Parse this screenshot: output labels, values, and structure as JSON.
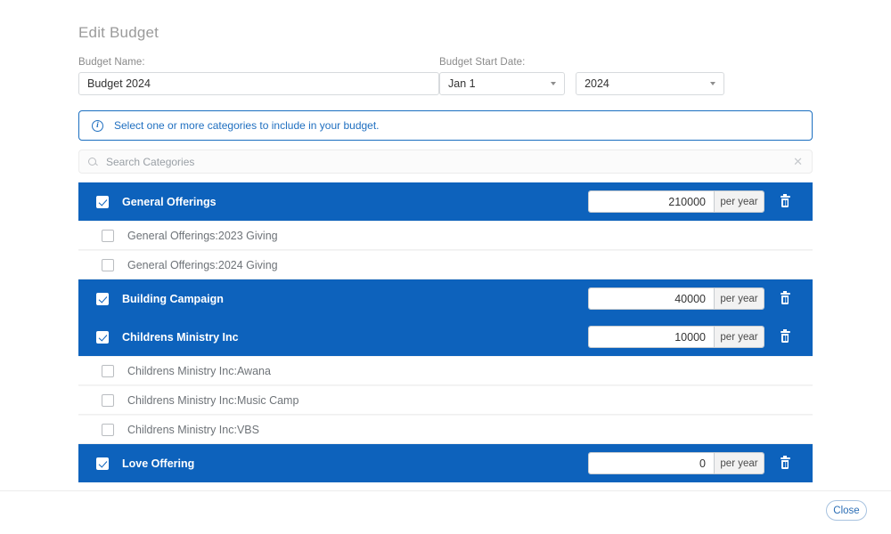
{
  "header": {
    "title": "Edit Budget"
  },
  "form": {
    "budget_name": {
      "label": "Budget Name:",
      "value": "Budget 2024",
      "placeholder": ""
    },
    "budget_start_date": {
      "label": "Budget Start Date:",
      "month_value": "Jan 1",
      "year_value": "2024"
    }
  },
  "info_banner": {
    "icon": "info-circle-icon",
    "text": "Select one or more categories to include in your budget."
  },
  "search": {
    "icon": "search-icon",
    "placeholder": "Search Categories",
    "value": "",
    "clear_icon": "close-x-icon"
  },
  "colors": {
    "selected_row": "#0d62bc",
    "accent_link": "#1f6fc0",
    "title_gray": "#9b9b9b"
  },
  "categories": [
    {
      "label": "General Offerings",
      "selected": true,
      "amount": "210000",
      "unit": "per year",
      "sub": false,
      "delete_icon": "trash-icon"
    },
    {
      "label": "General Offerings:2023 Giving",
      "selected": false,
      "amount": "",
      "unit": "",
      "sub": true
    },
    {
      "label": "General Offerings:2024 Giving",
      "selected": false,
      "amount": "",
      "unit": "",
      "sub": true
    },
    {
      "label": "Building Campaign",
      "selected": true,
      "amount": "40000",
      "unit": "per year",
      "sub": false,
      "delete_icon": "trash-icon"
    },
    {
      "label": "Childrens Ministry Inc",
      "selected": true,
      "amount": "10000",
      "unit": "per year",
      "sub": false,
      "delete_icon": "trash-icon"
    },
    {
      "label": "Childrens Ministry Inc:Awana",
      "selected": false,
      "amount": "",
      "unit": "",
      "sub": true
    },
    {
      "label": "Childrens Ministry Inc:Music Camp",
      "selected": false,
      "amount": "",
      "unit": "",
      "sub": true
    },
    {
      "label": "Childrens Ministry Inc:VBS",
      "selected": false,
      "amount": "",
      "unit": "",
      "sub": true
    },
    {
      "label": "Love Offering",
      "selected": true,
      "amount": "0",
      "unit": "per year",
      "sub": false,
      "delete_icon": "trash-icon"
    }
  ],
  "footer": {
    "close_label": "Close"
  }
}
